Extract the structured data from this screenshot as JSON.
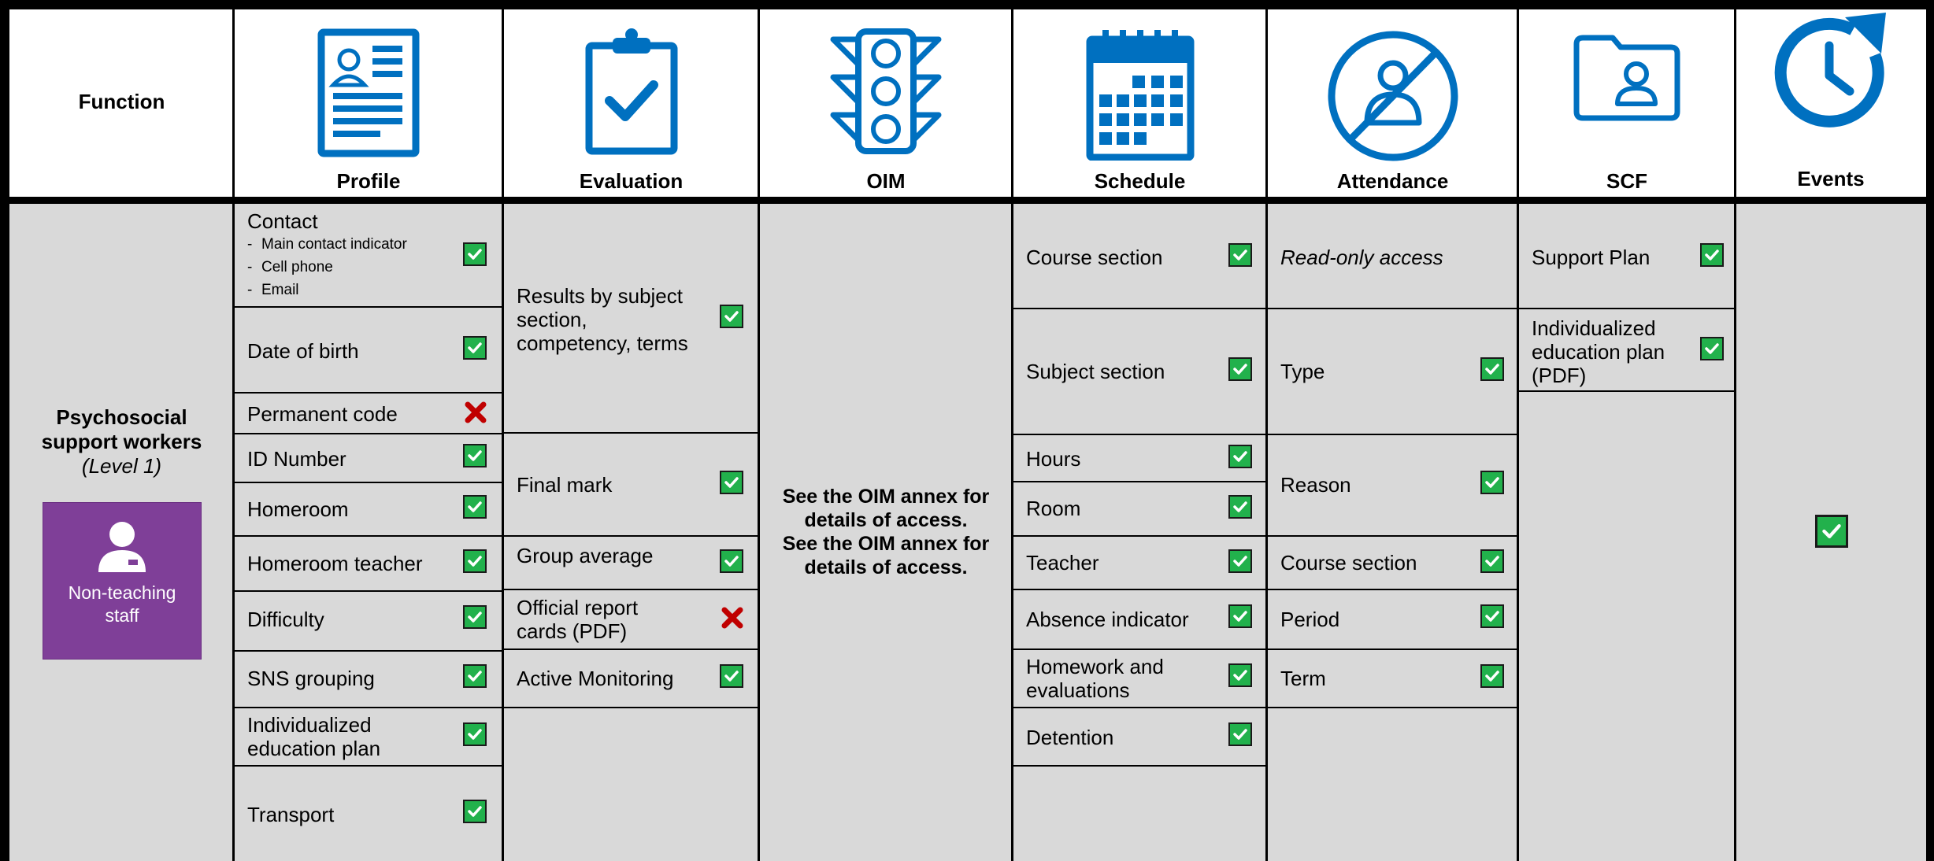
{
  "header": {
    "function_label": "Function",
    "columns": [
      {
        "label": "Profile",
        "icon": "profile-document-icon"
      },
      {
        "label": "Evaluation",
        "icon": "clipboard-check-icon"
      },
      {
        "label": "OIM",
        "icon": "traffic-light-icon"
      },
      {
        "label": "Schedule",
        "icon": "calendar-icon"
      },
      {
        "label": "Attendance",
        "icon": "person-crossed-icon"
      },
      {
        "label": "SCF",
        "icon": "folder-person-icon"
      },
      {
        "label": "Events",
        "icon": "clock-refresh-icon"
      }
    ]
  },
  "role": {
    "name_line1": "Psychosocial",
    "name_line2": "support workers",
    "level": "(Level 1)",
    "card_line1": "Non-teaching",
    "card_line2": "staff"
  },
  "profile": {
    "contact": {
      "title": "Contact",
      "sub1": "Main contact indicator",
      "sub2": "Cell phone",
      "sub3": "Email",
      "access": "yes"
    },
    "date_of_birth": "Date of birth",
    "permanent_code": "Permanent code",
    "id_number": "ID Number",
    "homeroom": "Homeroom",
    "homeroom_teacher": "Homeroom teacher",
    "difficulty": "Difficulty",
    "sns_grouping": "SNS grouping",
    "iep_line1": "Individualized",
    "iep_line2": "education plan",
    "transport": "Transport"
  },
  "evaluation": {
    "results_line1": "Results by subject",
    "results_line2": "section,",
    "results_line3": "competency, terms",
    "final_mark": "Final mark",
    "group_average": "Group average",
    "report_line1": "Official report",
    "report_line2": "cards (PDF)",
    "active_monitoring": "Active Monitoring"
  },
  "oim": {
    "note_line1": "See the OIM annex for",
    "note_line2": "details of access.",
    "note_line3": "See the OIM annex for",
    "note_line4": "details of access."
  },
  "schedule": {
    "course_section": "Course section",
    "subject_section": "Subject section",
    "hours": "Hours",
    "room": "Room",
    "teacher": "Teacher",
    "absence_indicator": "Absence indicator",
    "homework_line1": "Homework and",
    "homework_line2": "evaluations",
    "detention": "Detention"
  },
  "attendance": {
    "read_only": "Read-only access",
    "type": "Type",
    "reason": "Reason",
    "course_section": "Course section",
    "period": "Period",
    "term": "Term"
  },
  "scf": {
    "support_plan": "Support Plan",
    "iep_line1": "Individualized",
    "iep_line2": "education plan",
    "iep_line3": "(PDF)"
  },
  "colors": {
    "icon_blue": "#0070c0",
    "check_green": "#22b14c",
    "cross_red": "#c00000",
    "role_purple": "#7f3f98",
    "body_gray": "#d9d9d9"
  }
}
